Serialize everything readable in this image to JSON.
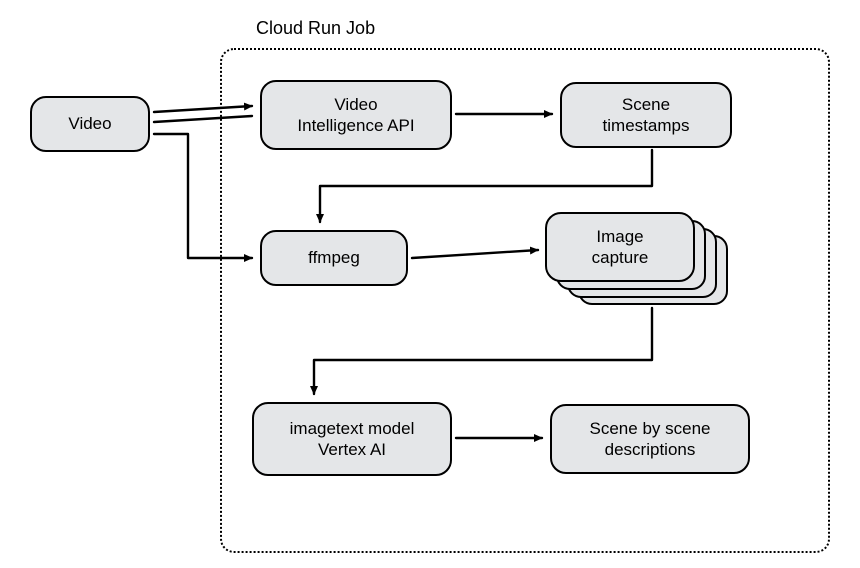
{
  "container": {
    "title": "Cloud Run Job"
  },
  "nodes": {
    "video": "Video",
    "video_intelligence": "Video\nIntelligence API",
    "scene_timestamps": "Scene\ntimestamps",
    "ffmpeg": "ffmpeg",
    "image_capture": "Image\ncapture",
    "imagetext": "imagetext model\nVertex AI",
    "scene_descriptions": "Scene by scene\ndescriptions"
  },
  "flow": [
    [
      "video",
      "video_intelligence"
    ],
    [
      "video",
      "ffmpeg"
    ],
    [
      "video_intelligence",
      "scene_timestamps"
    ],
    [
      "scene_timestamps",
      "ffmpeg"
    ],
    [
      "ffmpeg",
      "image_capture"
    ],
    [
      "image_capture",
      "imagetext"
    ],
    [
      "imagetext",
      "scene_descriptions"
    ]
  ]
}
